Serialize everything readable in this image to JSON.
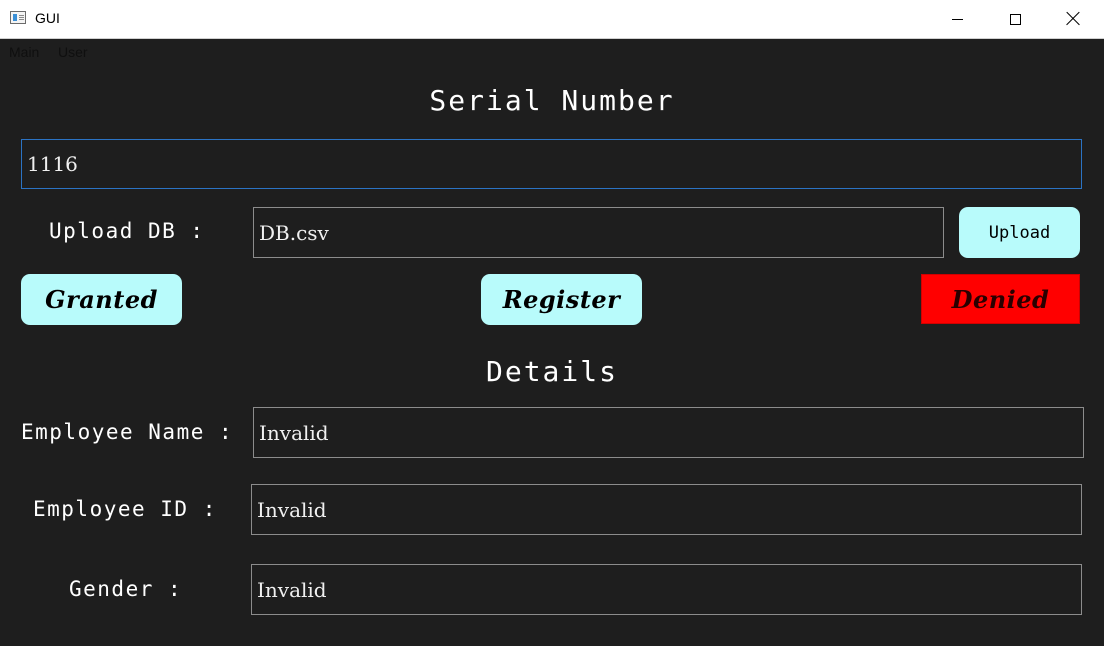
{
  "window": {
    "title": "GUI"
  },
  "menu": {
    "items": [
      "Main",
      "User"
    ]
  },
  "serial": {
    "heading": "Serial Number",
    "value": "1116"
  },
  "upload": {
    "label": "Upload DB :",
    "value": "DB.csv",
    "button": "Upload"
  },
  "actions": {
    "granted": "Granted",
    "register": "Register",
    "denied": "Denied",
    "denied_color": "#ff0000",
    "button_color": "#b8fbfb"
  },
  "details": {
    "heading": "Details",
    "name_label": "Employee Name :",
    "name_value": "Invalid",
    "id_label": "Employee ID :",
    "id_value": "Invalid",
    "gender_label": "Gender :",
    "gender_value": "Invalid"
  }
}
